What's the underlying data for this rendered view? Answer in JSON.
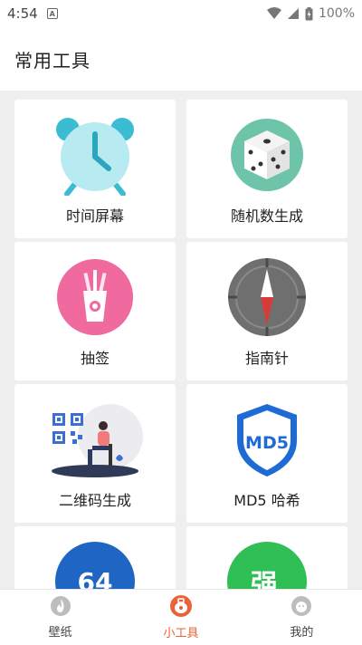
{
  "status_bar": {
    "time": "4:54",
    "battery": "100%"
  },
  "header": {
    "title": "常用工具"
  },
  "tools": [
    {
      "label": "时间屏幕"
    },
    {
      "label": "随机数生成"
    },
    {
      "label": "抽签"
    },
    {
      "label": "指南针"
    },
    {
      "label": "二维码生成"
    },
    {
      "label": "MD5 哈希"
    },
    {
      "label": "",
      "badge": "64"
    },
    {
      "label": "",
      "badge": "强"
    }
  ],
  "md5_badge_text": "MD5",
  "tabs": [
    {
      "label": "壁纸",
      "active": false
    },
    {
      "label": "小工具",
      "active": true
    },
    {
      "label": "我的",
      "active": false
    }
  ],
  "colors": {
    "accent": "#e8623a",
    "background": "#efefef"
  }
}
